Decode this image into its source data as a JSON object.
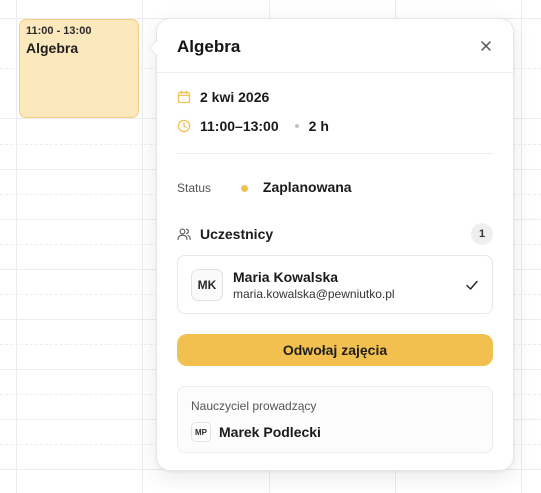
{
  "calendar": {
    "event": {
      "time": "11:00 - 13:00",
      "title": "Algebra"
    }
  },
  "popover": {
    "title": "Algebra",
    "date": "2 kwi 2026",
    "time_range": "11:00–13:00",
    "duration": "2 h",
    "status_label": "Status",
    "status_value": "Zaplanowana",
    "participants_label": "Uczestnicy",
    "participants_count": "1",
    "participants": [
      {
        "initials": "MK",
        "name": "Maria Kowalska",
        "email": "maria.kowalska@pewniutko.pl"
      }
    ],
    "cancel_label": "Odwołaj zajęcia",
    "teacher_label": "Nauczyciel prowadzący",
    "teacher_initials": "MP",
    "teacher_name": "Marek Podlecki"
  },
  "colors": {
    "accent": "#f2c04f",
    "event_bg": "#fbe8bd",
    "status_dot": "#f2c04f"
  },
  "icons": [
    "calendar-icon",
    "clock-icon",
    "users-icon",
    "close-icon",
    "check-icon"
  ]
}
